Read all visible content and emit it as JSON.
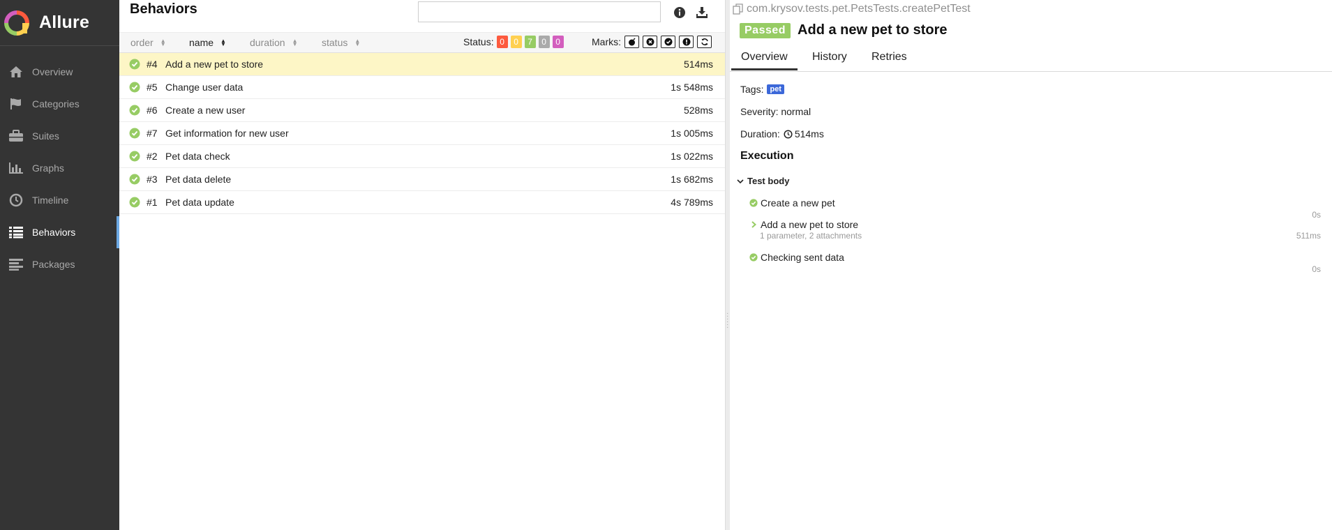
{
  "brand": {
    "name": "Allure"
  },
  "nav": [
    {
      "label": "Overview",
      "icon": "home-icon"
    },
    {
      "label": "Categories",
      "icon": "flag-icon"
    },
    {
      "label": "Suites",
      "icon": "briefcase-icon"
    },
    {
      "label": "Graphs",
      "icon": "bar-chart-icon"
    },
    {
      "label": "Timeline",
      "icon": "clock-icon"
    },
    {
      "label": "Behaviors",
      "icon": "list-icon",
      "active": true
    },
    {
      "label": "Packages",
      "icon": "align-left-icon"
    }
  ],
  "list": {
    "title": "Behaviors",
    "search_value": "",
    "columns": {
      "order": "order",
      "name": "name",
      "duration": "duration",
      "status": "status"
    },
    "status_label": "Status:",
    "status_counts": [
      {
        "status": "failed",
        "count": "0",
        "color": "#fd5a3e"
      },
      {
        "status": "broken",
        "count": "0",
        "color": "#ffd050"
      },
      {
        "status": "passed",
        "count": "7",
        "color": "#97cc64"
      },
      {
        "status": "skipped",
        "count": "0",
        "color": "#aaaaaa"
      },
      {
        "status": "unknown",
        "count": "0",
        "color": "#d35ebe"
      }
    ],
    "marks_label": "Marks:",
    "rows": [
      {
        "order": "#4",
        "name": "Add a new pet to store",
        "duration": "514ms",
        "selected": true
      },
      {
        "order": "#5",
        "name": "Change user data",
        "duration": "1s 548ms"
      },
      {
        "order": "#6",
        "name": "Create a new user",
        "duration": "528ms"
      },
      {
        "order": "#7",
        "name": "Get information for new user",
        "duration": "1s 005ms"
      },
      {
        "order": "#2",
        "name": "Pet data check",
        "duration": "1s 022ms"
      },
      {
        "order": "#3",
        "name": "Pet data delete",
        "duration": "1s 682ms"
      },
      {
        "order": "#1",
        "name": "Pet data update",
        "duration": "4s 789ms"
      }
    ]
  },
  "detail": {
    "full_name": "com.krysov.tests.pet.PetsTests.createPetTest",
    "status": "Passed",
    "title": "Add a new pet to store",
    "tabs": [
      "Overview",
      "History",
      "Retries"
    ],
    "tags_label": "Tags:",
    "tag": "pet",
    "severity": "Severity: normal",
    "duration_label": "Duration:",
    "duration": "514ms",
    "execution_title": "Execution",
    "test_body_label": "Test body",
    "steps": [
      {
        "name": "Create a new pet",
        "duration": "0s"
      },
      {
        "name": "Add a new pet to store",
        "sub": "1 parameter, 2 attachments",
        "duration": "511ms"
      },
      {
        "name": "Checking sent data",
        "duration": "0s"
      }
    ]
  },
  "colors": {
    "sidebar": "#343434",
    "accent": "#6da9e4",
    "passed": "#97cc64",
    "tag": "#3c68d9",
    "selected_row": "#fdf6c6"
  }
}
